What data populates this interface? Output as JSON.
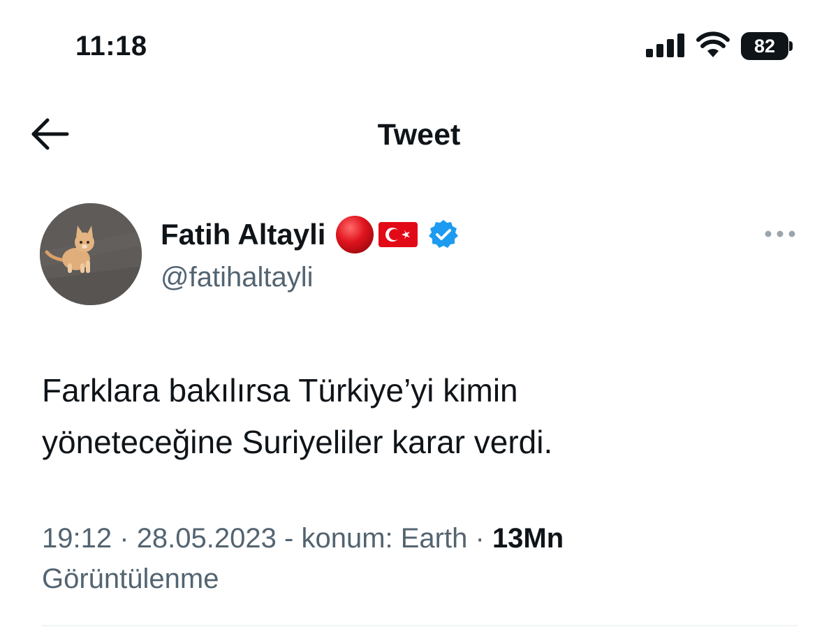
{
  "status_bar": {
    "time": "11:18",
    "battery_level": "82",
    "icons": [
      "cellular-signal-icon",
      "wifi-icon",
      "battery-icon"
    ]
  },
  "header": {
    "title": "Tweet",
    "back_icon": "back-arrow-icon"
  },
  "tweet": {
    "author": {
      "name": "Fatih Altayli",
      "handle": "@fatihaltayli",
      "badges": [
        "red-circle-emoji",
        "turkey-flag-emoji",
        "verified-badge-icon"
      ],
      "avatar": "avatar-orange-kitten"
    },
    "text_lines": [
      "Farklara bakılırsa Türkiye’yi kimin",
      "yöneteceğine Suriyeliler karar verdi."
    ],
    "meta": {
      "time": "19:12",
      "separator": "·",
      "date": "28.05.2023",
      "dash": "-",
      "location": "konum: Earth",
      "views_count": "13Mn",
      "views_label": "Görüntülenme"
    },
    "more_icon": "more-options-icon"
  },
  "colors": {
    "text_primary": "#0f1419",
    "text_secondary": "#536471",
    "verified_blue": "#1d9bf0",
    "flag_red": "#e30a17",
    "divider": "#eff3f4"
  }
}
